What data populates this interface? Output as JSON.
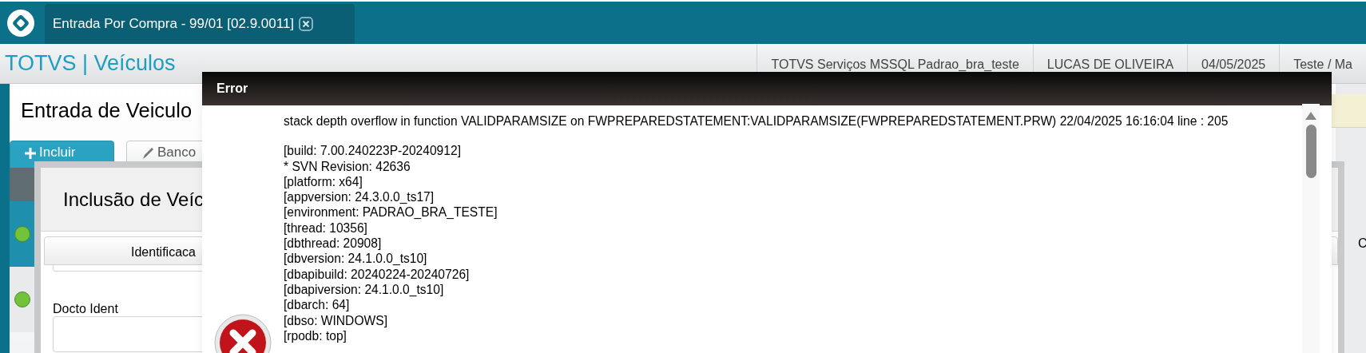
{
  "app_tab": {
    "title": "Entrada Por Compra - 99/01 [02.9.0011]",
    "selected": true
  },
  "header": {
    "title": "TOTVS | Veículos",
    "info": [
      "TOTVS Serviços MSSQL Padrao_bra_teste",
      "LUCAS DE OLIVEIRA",
      "04/05/2025",
      "Teste / Ma"
    ]
  },
  "page": {
    "title": "Entrada de Veiculo",
    "buttons": [
      {
        "label": "Incluir",
        "kind": "primary"
      },
      {
        "label": "Banco",
        "kind": "secondary"
      }
    ]
  },
  "grid_rows": [
    {
      "color": "#72c23a"
    },
    {
      "color": "#72c23a"
    }
  ],
  "modal": {
    "title": "Inclusão de Veíc",
    "tabs": [
      {
        "label": "Identificaca",
        "selected": true
      }
    ],
    "field": {
      "label": "Docto Ident"
    }
  },
  "side": {
    "column_label": "C"
  },
  "error_dialog": {
    "title": "Error",
    "message": "stack depth overflow in function VALIDPARAMSIZE on FWPREPAREDSTATEMENT:VALIDPARAMSIZE(FWPREPAREDSTATEMENT.PRW) 22/04/2025 16:16:04 line : 205",
    "details": [
      "[build: 7.00.240223P-20240912]",
      "* SVN Revision: 42636",
      "[platform: x64]",
      "[appversion: 24.3.0.0_ts17]",
      "[environment: PADRAO_BRA_TESTE]",
      "[thread: 10356]",
      "[dbthread: 20908]",
      "[dbversion: 24.1.0.0_ts10]",
      "[dbapibuild: 20240224-20240726]",
      "[dbapiversion: 24.1.0.0_ts10]",
      "[dbarch: 64]",
      "[dbso: WINDOWS]",
      "[rpodb: top]"
    ]
  }
}
